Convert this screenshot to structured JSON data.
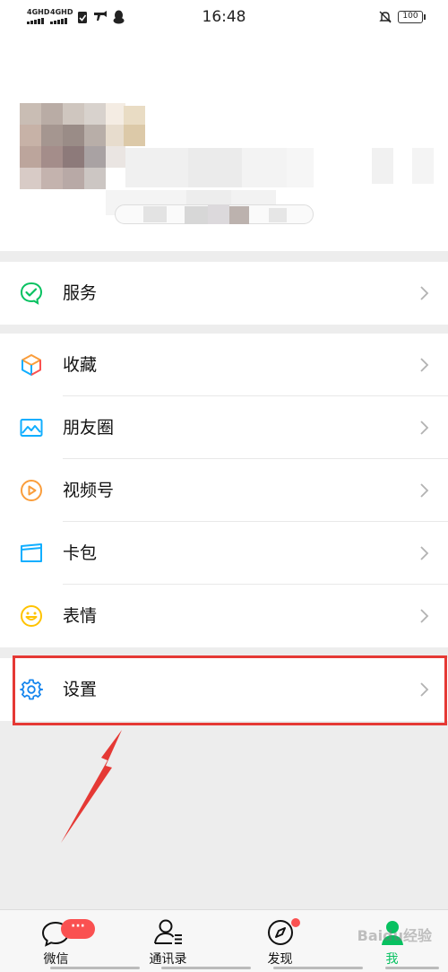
{
  "status_bar": {
    "signal_1": "4GHD",
    "signal_2": "4GHD",
    "time": "16:48",
    "battery": "100"
  },
  "menu": {
    "service": "服务",
    "favorites": "收藏",
    "moments": "朋友圈",
    "channels": "视频号",
    "cards": "卡包",
    "stickers": "表情",
    "settings": "设置"
  },
  "tabbar": {
    "chats": "微信",
    "chats_badge": "···",
    "contacts": "通讯录",
    "discover": "发现",
    "me": "我"
  },
  "watermark": "Baidu经验",
  "colors": {
    "wechat_green": "#07c160",
    "badge_red": "#fa5151",
    "highlight_red": "#e53935"
  }
}
